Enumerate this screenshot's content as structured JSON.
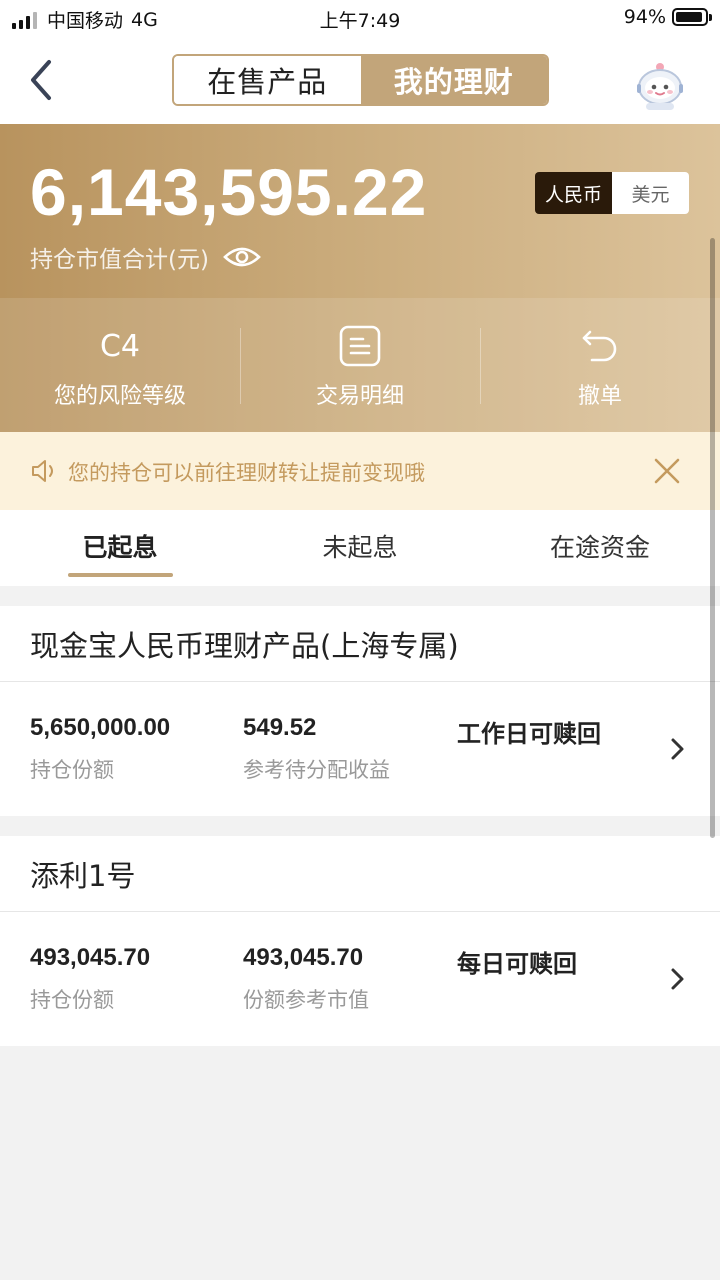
{
  "status_bar": {
    "carrier": "中国移动",
    "network": "4G",
    "time": "上午7:49",
    "battery": "94%",
    "battery_level": 0.94
  },
  "nav": {
    "tabs": [
      {
        "label": "在售产品",
        "active": false
      },
      {
        "label": "我的理财",
        "active": true
      }
    ],
    "back_icon": "chevron-left-icon",
    "assistant_icon": "robot-assistant-icon"
  },
  "summary": {
    "amount": "6,143,595.22",
    "amount_label": "持仓市值合计(元)",
    "currency_options": [
      {
        "label": "人民币",
        "active": true
      },
      {
        "label": "美元",
        "active": false
      }
    ],
    "actions": [
      {
        "value": "C4",
        "label": "您的风险等级"
      },
      {
        "icon": "document-list-icon",
        "label": "交易明细"
      },
      {
        "icon": "undo-icon",
        "label": "撤单"
      }
    ]
  },
  "notice": {
    "text": "您的持仓可以前往理财转让提前变现哦",
    "icon": "speaker-icon",
    "close_icon": "close-icon"
  },
  "tabs": [
    {
      "label": "已起息",
      "active": true
    },
    {
      "label": "未起息",
      "active": false
    },
    {
      "label": "在途资金",
      "active": false
    }
  ],
  "holdings": [
    {
      "title": "现金宝人民币理财产品(上海专属)",
      "col1_value": "5,650,000.00",
      "col1_label": "持仓份额",
      "col2_value": "549.52",
      "col2_label": "参考待分配收益",
      "redeem": "工作日可赎回"
    },
    {
      "title": "添利1号",
      "col1_value": "493,045.70",
      "col1_label": "持仓份额",
      "col2_value": "493,045.70",
      "col2_label": "份额参考市值",
      "redeem": "每日可赎回"
    }
  ],
  "colors": {
    "gold": "#c2a57a",
    "notice_bg": "#fcf2dc",
    "notice_text": "#c49a5e",
    "currency_active_bg": "#2a1a0a"
  }
}
